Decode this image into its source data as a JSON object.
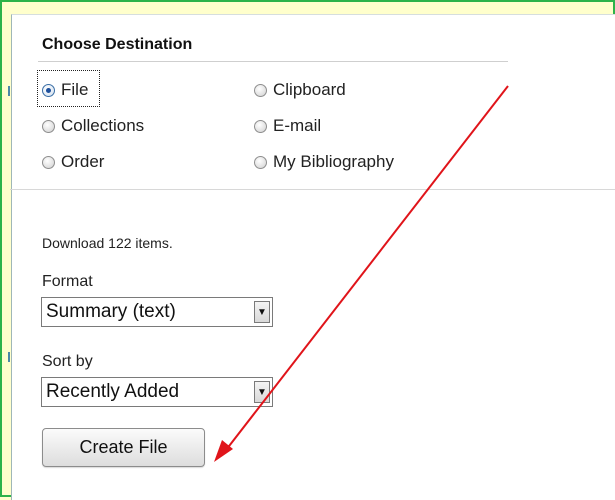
{
  "panel": {
    "title": "Choose Destination",
    "destinations": [
      {
        "label": "File",
        "selected": true
      },
      {
        "label": "Collections",
        "selected": false
      },
      {
        "label": "Order",
        "selected": false
      },
      {
        "label": "Clipboard",
        "selected": false
      },
      {
        "label": "E-mail",
        "selected": false
      },
      {
        "label": "My Bibliography",
        "selected": false
      }
    ],
    "download_text": "Download 122 items.",
    "format": {
      "label": "Format",
      "value": "Summary (text)"
    },
    "sort": {
      "label": "Sort by",
      "value": "Recently Added"
    },
    "create_button": "Create File"
  },
  "colors": {
    "frame_border": "#2db34a",
    "frame_background": "#ffffcc",
    "annotation_arrow": "#e0141a"
  },
  "annotation": {
    "icon": "red-arrow-icon"
  }
}
